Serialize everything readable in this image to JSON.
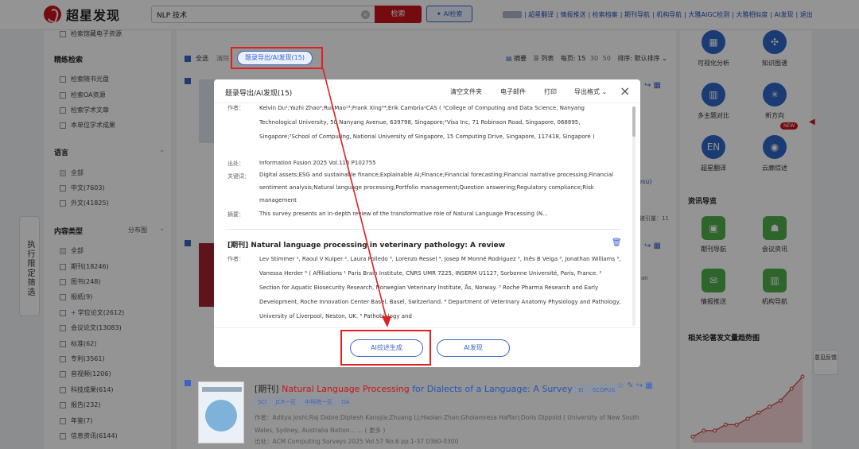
{
  "header": {
    "logo_text": "超星发现",
    "search_value": "NLP 技术",
    "search_button": "检索",
    "ai_search_button": "AI检索",
    "links": [
      "超星翻译",
      "情报推送",
      "检索档案",
      "期刊导航",
      "机构导航",
      "大雅AIGC检测",
      "大雅相似度",
      "AI发现",
      "退出"
    ]
  },
  "left": {
    "top_item": "检索馆藏电子资源",
    "refine_title": "精练检索",
    "refine_items": [
      "检索随书光盘",
      "检索OA资源",
      "检索学术文章",
      "本单位学术成果"
    ],
    "language_title": "语言",
    "language_items": [
      "全部",
      "中文(7603)",
      "外文(41825)"
    ],
    "content_type_title": "内容类型",
    "distribution_label": "分布图",
    "content_items": [
      "全部",
      "期刊(18246)",
      "图书(248)",
      "报纸(9)",
      "学位论文(2612)",
      "会议论文(13083)",
      "标准(62)",
      "专利(3561)",
      "音视频(1206)",
      "科技成果(614)",
      "报告(232)",
      "年鉴(7)",
      "信息资讯(6144)"
    ],
    "side_tab": "执行限定筛选"
  },
  "main": {
    "select_all": "全选",
    "clear": "清除",
    "export_pill": "题录导出/AI发现(15)",
    "abstract_view": "摘要",
    "list_view": "列表",
    "per_page_label": "每页:",
    "per_page_options": [
      "15",
      "30",
      "50"
    ],
    "sort_label": "排序:",
    "sort_value": "默认排序",
    "bsu_link": "bsu)",
    "cited": "被引量：11",
    "an_text": "an"
  },
  "modal": {
    "title": "题录导出/AI发现(15)",
    "actions": [
      "清空文件夹",
      "电子邮件",
      "打印",
      "导出格式"
    ],
    "labels": {
      "author": "作者：",
      "source": "出处：",
      "keywords": "关键词：",
      "abstract": "摘要："
    },
    "article1": {
      "authors": "Kelvin Du¹;Yazhi Zhao²;Rui Mao¹³;Frank Xing³⁴;Erik Cambria¹CAS ( ¹College of Computing and Data Science, Nanyang Technological University, 50 Nanyang Avenue, 639798, Singapore;²Visa Inc, 71 Robinson Road, Singapore, 068895, Singapore;³School of Computing, National University of Singapore, 15 Computing Drive, Singapore, 117418, Singapore )",
      "source": "Information Fusion 2025 Vol.115 P102755",
      "keywords": "Digital assets;ESG and sustainable finance;Explainable AI;Finance;Financial forecasting;Financial narrative processing;Financial sentiment analysis;Natural language processing;Portfolio management;Question answering;Regulatory compliance;Risk management",
      "abstract": "This survey presents an in-depth review of the transformative role of Natural Language Processing (N..."
    },
    "article2": {
      "title": "[期刊] Natural language processing in veterinary pathology: A review",
      "authors": "Lev Stimmer ¹, Raoul V Kuiper ², Laura Polledo ³, Lorenzo Ressel ⁴, Josep M Monné Rodriguez ³, Inês B Veiga ³, Jonathan Williams ⁵, Vanessa Herder ⁶ ( Affiliations ¹ Paris Brain Institute, CNRS UMR 7225, INSERM U1127, Sorbonne Université, Paris, France. ² Section for Aquatic Biosecurity Research, Norwegian Veterinary Institute, Ås, Norway. ³ Roche Pharma Research and Early Development, Roche Innovation Center Basel, Basel, Switzerland. ⁴ Department of Veterinary Anatomy Physiology and Pathology, University of Liverpool, Neston, UK. ⁵ Pathobiology and"
    },
    "btn_ai_review": "AI综述生成",
    "btn_ai_discover": "AI发现"
  },
  "result": {
    "prefix": "[期刊]",
    "title_red": "Natural Language Processing",
    "title_rest": "for Dialects of a Language: A Survey",
    "badges": [
      "EI",
      "SCOPUS"
    ],
    "tags": [
      "SCI",
      "JCR一区",
      "中科院一区",
      "OA"
    ],
    "authors": "作者：Aditya Joshi;Raj Dabre;Diptesh Kanojia;Zhuang Li;Haolan Zhan;Gholamreza Haffari;Doris Dippold ( University of New South Wales, Sydney, Australia Nation... ...  ( 更多 )",
    "source": "出处：ACM Computing Surveys 2025 Vol.57 No.6 pp.1-37 0360-0300"
  },
  "right": {
    "tools": [
      "可视化分析",
      "知识图谱",
      "多主题对比",
      "新方向",
      "超星翻译",
      "云廊综述"
    ],
    "new_badge": "NEW",
    "nav_title": "资讯导览",
    "nav_items": [
      "期刊导航",
      "会议资讯",
      "情报推送",
      "机构导航"
    ],
    "trend_title": "相关论著发文量趋势图",
    "feedback": "意见反馈",
    "trend_values": [
      1,
      2,
      2,
      3,
      3,
      4,
      5,
      6,
      7,
      9,
      11
    ]
  },
  "colors": {
    "brand": "#c8141b",
    "link": "#2454b8",
    "accent": "#3a64c9",
    "annotation": "#e02020"
  }
}
